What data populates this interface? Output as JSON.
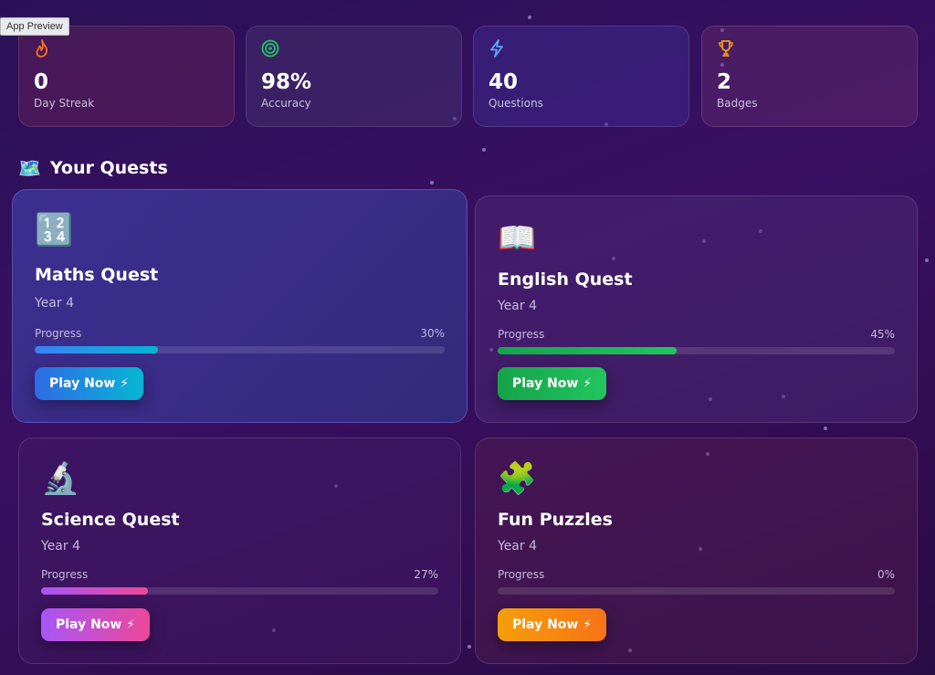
{
  "app": {
    "preview_label": "App Preview"
  },
  "stats": [
    {
      "icon": "flame-icon",
      "glyph": "♨",
      "value": "0",
      "label": "Day Streak",
      "color": "#f97316"
    },
    {
      "icon": "target-icon",
      "glyph": "◎",
      "value": "98%",
      "label": "Accuracy",
      "color": "#22c55e"
    },
    {
      "icon": "lightning-icon",
      "glyph": "ϟ",
      "value": "40",
      "label": "Questions",
      "color": "#60a5fa"
    },
    {
      "icon": "trophy-icon",
      "glyph": "🏆",
      "value": "2",
      "label": "Badges",
      "color": "#f59e0b"
    }
  ],
  "section": {
    "icon": "map-icon",
    "glyph": "🗺️",
    "title": "Your Quests"
  },
  "progress_label": "Progress",
  "play_label": "Play Now ⚡",
  "quests": [
    {
      "icon": "numbers-icon",
      "glyph": "🔢",
      "title": "Maths Quest",
      "year": "Year 4",
      "progress": "30%",
      "progress_value": 30,
      "accent": "#06b6d4"
    },
    {
      "icon": "book-icon",
      "glyph": "📖",
      "title": "English Quest",
      "year": "Year 4",
      "progress": "45%",
      "progress_value": 45,
      "accent": "#22c55e"
    },
    {
      "icon": "microscope-icon",
      "glyph": "🔬",
      "title": "Science Quest",
      "year": "Year 4",
      "progress": "27%",
      "progress_value": 27,
      "accent": "#ec4899"
    },
    {
      "icon": "puzzle-icon",
      "glyph": "🧩",
      "title": "Fun Puzzles",
      "year": "Year 4",
      "progress": "0%",
      "progress_value": 0,
      "accent": "#f97316"
    }
  ]
}
